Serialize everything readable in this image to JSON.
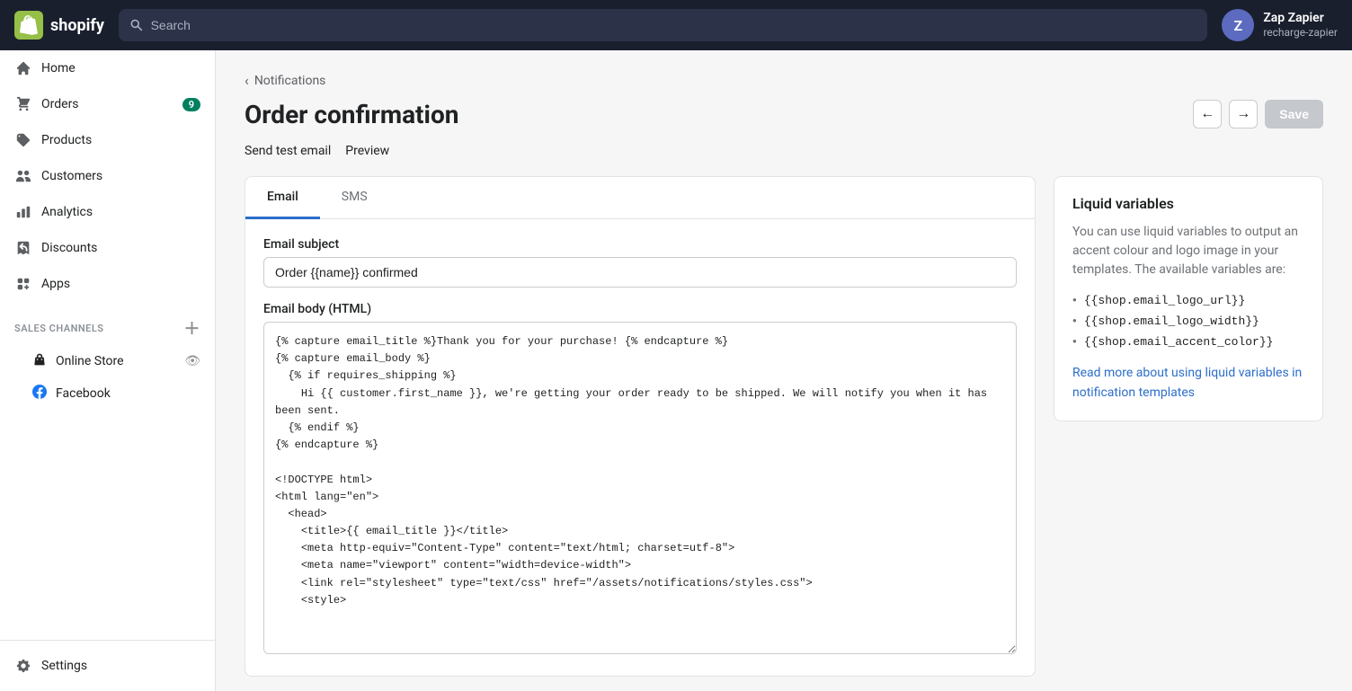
{
  "topnav": {
    "logo_text": "shopify",
    "search_placeholder": "Search",
    "user_name": "Zap Zapier",
    "user_sub": "recharge-zapier"
  },
  "sidebar": {
    "items": [
      {
        "id": "home",
        "label": "Home",
        "icon": "🏠",
        "badge": null
      },
      {
        "id": "orders",
        "label": "Orders",
        "icon": "📦",
        "badge": "9"
      },
      {
        "id": "products",
        "label": "Products",
        "icon": "🏷️",
        "badge": null
      },
      {
        "id": "customers",
        "label": "Customers",
        "icon": "👤",
        "badge": null
      },
      {
        "id": "analytics",
        "label": "Analytics",
        "icon": "📊",
        "badge": null
      },
      {
        "id": "discounts",
        "label": "Discounts",
        "icon": "🏷",
        "badge": null
      },
      {
        "id": "apps",
        "label": "Apps",
        "icon": "🧩",
        "badge": null
      }
    ],
    "sales_channels_header": "SALES CHANNELS",
    "sales_channel_items": [
      {
        "id": "online-store",
        "label": "Online Store",
        "icon": "🏪"
      },
      {
        "id": "facebook",
        "label": "Facebook",
        "icon": "📘"
      }
    ],
    "settings_label": "Settings"
  },
  "page": {
    "breadcrumb": "Notifications",
    "title": "Order confirmation",
    "save_label": "Save",
    "sub_actions": [
      {
        "id": "send-test",
        "label": "Send test email"
      },
      {
        "id": "preview",
        "label": "Preview"
      }
    ]
  },
  "tabs": [
    {
      "id": "email",
      "label": "Email",
      "active": true
    },
    {
      "id": "sms",
      "label": "SMS",
      "active": false
    }
  ],
  "email_form": {
    "subject_label": "Email subject",
    "subject_value": "Order {{name}} confirmed",
    "body_label": "Email body (HTML)",
    "body_value": "{% capture email_title %}Thank you for your purchase! {% endcapture %}\n{% capture email_body %}\n  {% if requires_shipping %}\n    Hi {{ customer.first_name }}, we're getting your order ready to be shipped. We will notify you when it has been sent.\n  {% endif %}\n{% endcapture %}\n\n<!DOCTYPE html>\n<html lang=\"en\">\n  <head>\n    <title>{{ email_title }}</title>\n    <meta http-equiv=\"Content-Type\" content=\"text/html; charset=utf-8\">\n    <meta name=\"viewport\" content=\"width=device-width\">\n    <link rel=\"stylesheet\" type=\"text/css\" href=\"/assets/notifications/styles.css\">\n    <style>"
  },
  "liquid_panel": {
    "title": "Liquid variables",
    "description": "You can use liquid variables to output an accent colour and logo image in your templates. The available variables are:",
    "variables": [
      "{{shop.email_logo_url}}",
      "{{shop.email_logo_width}}",
      "{{shop.email_accent_color}}"
    ],
    "link_text": "Read more about using liquid variables in notification templates"
  }
}
